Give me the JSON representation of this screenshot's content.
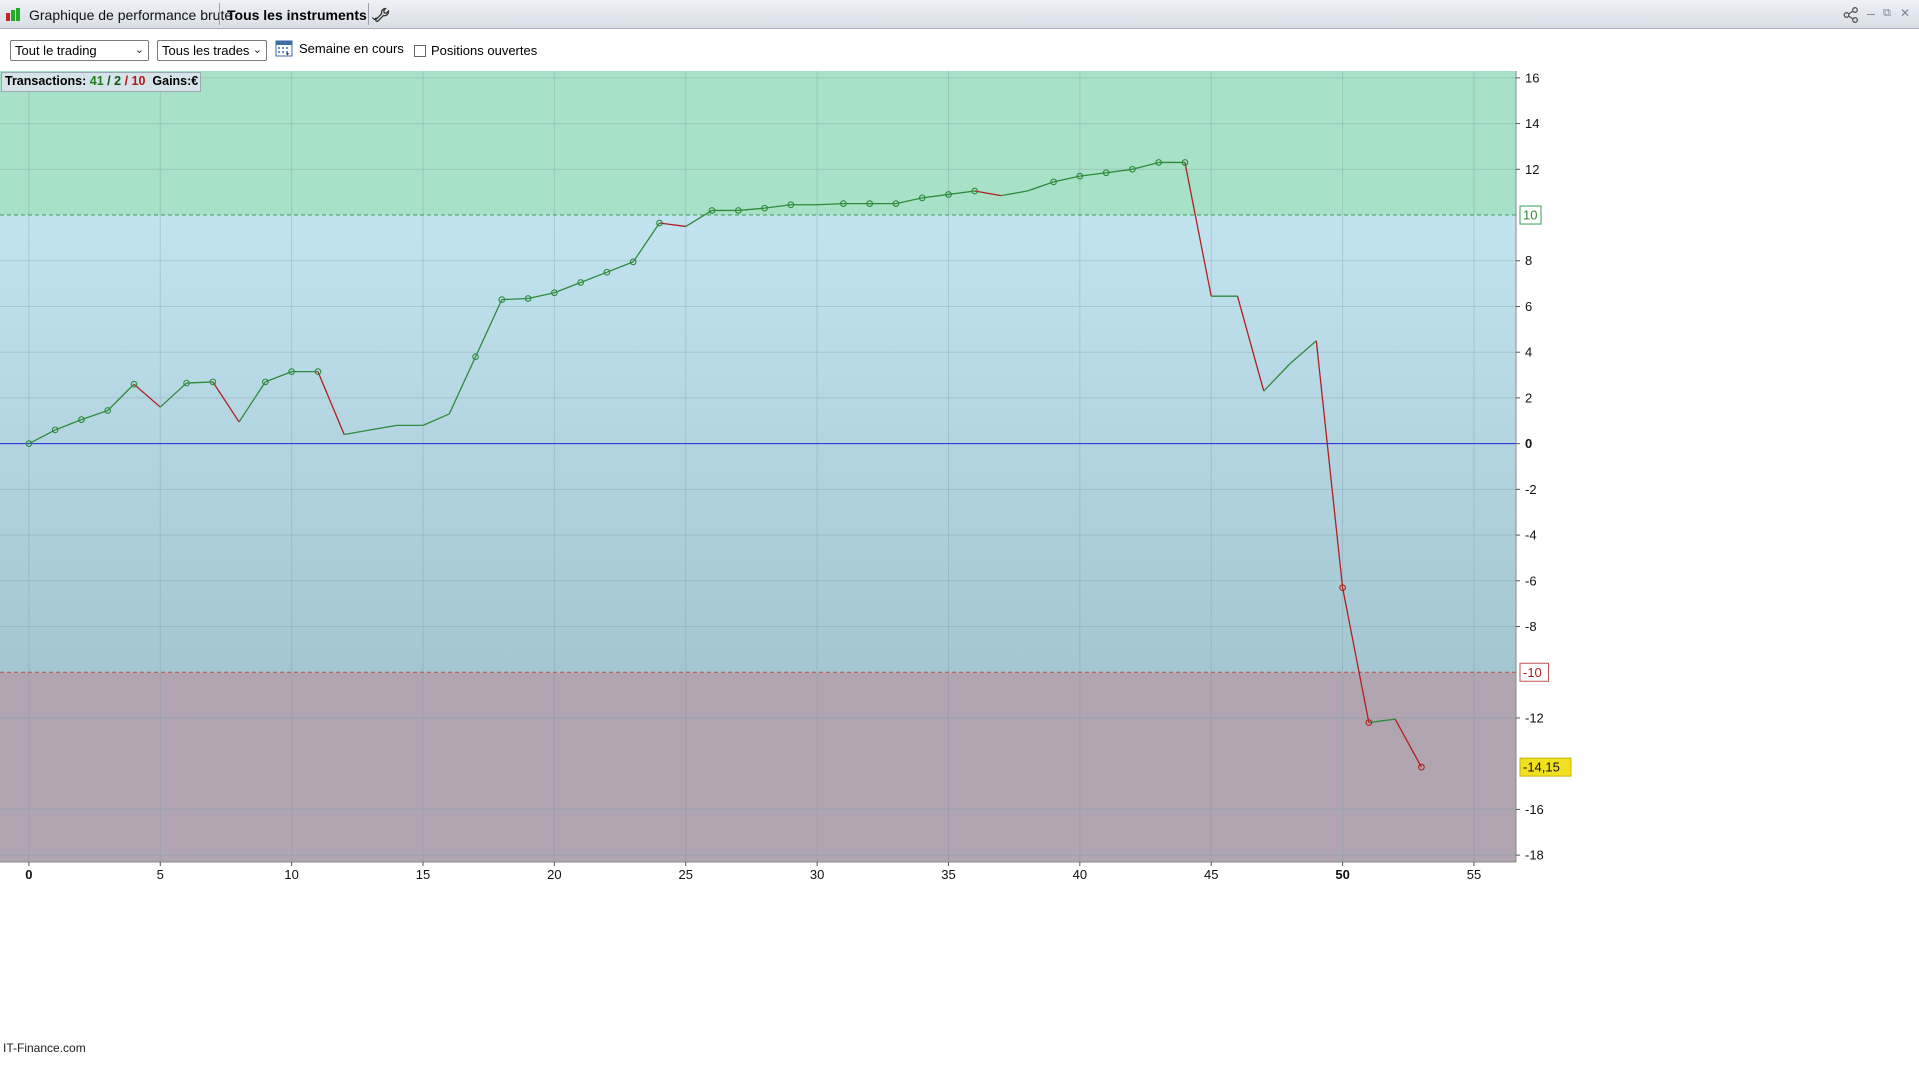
{
  "window": {
    "title": "Graphique de performance brute",
    "instruments_label": "Tous les instruments",
    "instruments_chevron": "⌄",
    "minimize": "–",
    "restore": "⧉",
    "close": "✕"
  },
  "toolbar": {
    "trading_select": "Tout le trading",
    "trades_select": "Tous les trades",
    "select_chevron": "⌄",
    "week_label": "Semaine en cours",
    "positions_label": "Positions ouvertes",
    "positions_checked": false
  },
  "stats": {
    "transactions_label": "Transactions:",
    "winners": "41",
    "slash1": "/",
    "breakeven": "2",
    "slash2": "/",
    "losers": "10",
    "gains_label": "Gains:",
    "gains_unit": "€"
  },
  "watermark": "IT-Finance.com",
  "colors": {
    "zone_profit": "#a7e1c7",
    "zone_neutral_top": "#c2e3f0",
    "zone_neutral_bottom": "#a4c6d1",
    "zone_loss": "#b0a5b0",
    "line_up": "#2e8b3a",
    "line_down": "#b02020",
    "zero_line": "#1f2bd6",
    "last_value_bg": "#f0e020"
  },
  "chart_data": {
    "type": "line",
    "ylim": [
      -18,
      16
    ],
    "xlim": [
      -1.1,
      56.6
    ],
    "x_ticks": [
      "0",
      "5",
      "10",
      "15",
      "20",
      "25",
      "30",
      "35",
      "40",
      "45",
      "50",
      "55"
    ],
    "x_tick_values": [
      0,
      5,
      10,
      15,
      20,
      25,
      30,
      35,
      40,
      45,
      50,
      55
    ],
    "bold_x_ticks": [
      "0",
      "50"
    ],
    "y_ticks": [
      "16",
      "14",
      "12",
      "8",
      "6",
      "4",
      "2",
      "0",
      "-2",
      "-4",
      "-6",
      "-8",
      "-12",
      "-16",
      "-18"
    ],
    "y_tick_values": [
      16,
      14,
      12,
      8,
      6,
      4,
      2,
      0,
      -2,
      -4,
      -6,
      -8,
      -12,
      -16,
      -18
    ],
    "upper_threshold": 10,
    "upper_threshold_label": "10",
    "lower_threshold": -10,
    "lower_threshold_label": "-10",
    "last_value_label": "-14,15",
    "last_value": -14.15,
    "zero_line": true,
    "grid": true,
    "series": [
      {
        "x": [
          0,
          1,
          2,
          3,
          4,
          5,
          6,
          7,
          8,
          9,
          10,
          11,
          12,
          13,
          14,
          15,
          16,
          17,
          18,
          19,
          20,
          21,
          22,
          23,
          24,
          25,
          26,
          27,
          28,
          29,
          30,
          31,
          32,
          33,
          34,
          35,
          36,
          37,
          38,
          39,
          40,
          41,
          42,
          43,
          44,
          45,
          46,
          47,
          48,
          49,
          50,
          51,
          52,
          53
        ],
        "y": [
          0,
          0.6,
          1.05,
          1.45,
          2.6,
          1.6,
          2.65,
          2.7,
          0.95,
          2.7,
          3.15,
          3.15,
          0.4,
          0.6,
          0.8,
          0.8,
          1.3,
          3.8,
          6.3,
          6.35,
          6.6,
          7.05,
          7.5,
          7.95,
          9.65,
          9.5,
          10.2,
          10.2,
          10.3,
          10.45,
          10.45,
          10.5,
          10.5,
          10.5,
          10.75,
          10.9,
          11.05,
          10.85,
          11.05,
          11.45,
          11.7,
          11.85,
          12,
          12.3,
          12.3,
          6.45,
          6.45,
          2.3,
          3.5,
          4.5,
          -6.3,
          -12.2,
          -12.05,
          -14.15
        ],
        "markers": [
          0,
          1,
          2,
          3,
          4,
          6,
          7,
          9,
          10,
          11,
          17,
          18,
          19,
          20,
          21,
          22,
          23,
          24,
          26,
          27,
          28,
          29,
          31,
          32,
          33,
          34,
          35,
          36,
          39,
          40,
          41,
          42,
          43,
          44,
          50,
          51,
          53
        ]
      }
    ]
  }
}
